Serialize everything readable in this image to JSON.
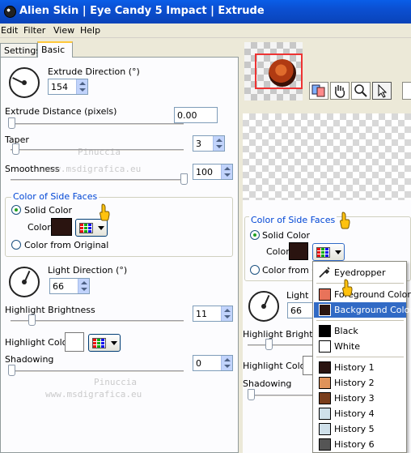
{
  "window": {
    "title": "Alien Skin | Eye Candy 5 Impact | Extrude"
  },
  "menu": {
    "items": [
      "Edit",
      "Filter",
      "View",
      "Help"
    ]
  },
  "tabs": [
    "Settings",
    "Basic"
  ],
  "controls": {
    "extrude_direction": {
      "label": "Extrude Direction (°)",
      "value": "154"
    },
    "extrude_distance": {
      "label": "Extrude Distance (pixels)",
      "value": "0.00"
    },
    "taper": {
      "label": "Taper",
      "value": "3"
    },
    "smoothness": {
      "label": "Smoothness",
      "value": "100"
    },
    "side_faces": {
      "title": "Color of Side Faces",
      "solid_label": "Solid Color",
      "color_label": "Color",
      "original_label": "Color from Original",
      "color": "#2a1410"
    },
    "light_direction": {
      "label": "Light Direction (°)",
      "value": "66"
    },
    "highlight_brightness": {
      "label": "Highlight Brightness",
      "value": "11"
    },
    "highlight_color": {
      "label": "Highlight Color",
      "color": "#ffffff"
    },
    "shadowing": {
      "label": "Shadowing",
      "value": "0"
    }
  },
  "watermark": {
    "name": "Pinuccia",
    "url": "www.msdigrafica.eu"
  },
  "inset": {
    "title": "Color of Side Faces",
    "solid_label": "Solid Color",
    "color_label": "Color",
    "original_label": "Color from Or",
    "light_label": "Light D",
    "light_value": "66",
    "highlight_brightness": "Highlight Brightnes",
    "highlight_color": "Highlight Color",
    "shadowing": "Shadowing"
  },
  "dropdown": {
    "eyedropper": "Eyedropper",
    "items": [
      {
        "label": "Foreground Color",
        "color": "#e8735a"
      },
      {
        "label": "Background Color",
        "color": "#2a1410",
        "selected": true
      }
    ],
    "bw": [
      {
        "label": "Black",
        "color": "#000000"
      },
      {
        "label": "White",
        "color": "#ffffff"
      }
    ],
    "history": [
      {
        "label": "History 1",
        "color": "#2a1410"
      },
      {
        "label": "History 2",
        "color": "#e0935a"
      },
      {
        "label": "History 3",
        "color": "#7a3e1c"
      },
      {
        "label": "History 4",
        "color": "#cfe0ea"
      },
      {
        "label": "History 5",
        "color": "#cfe0ea"
      },
      {
        "label": "History 6",
        "color": "#555555"
      }
    ]
  },
  "colors": {
    "titlebar": "#0b4fd1",
    "accent": "#0046d5",
    "selected": "#316ac5"
  }
}
